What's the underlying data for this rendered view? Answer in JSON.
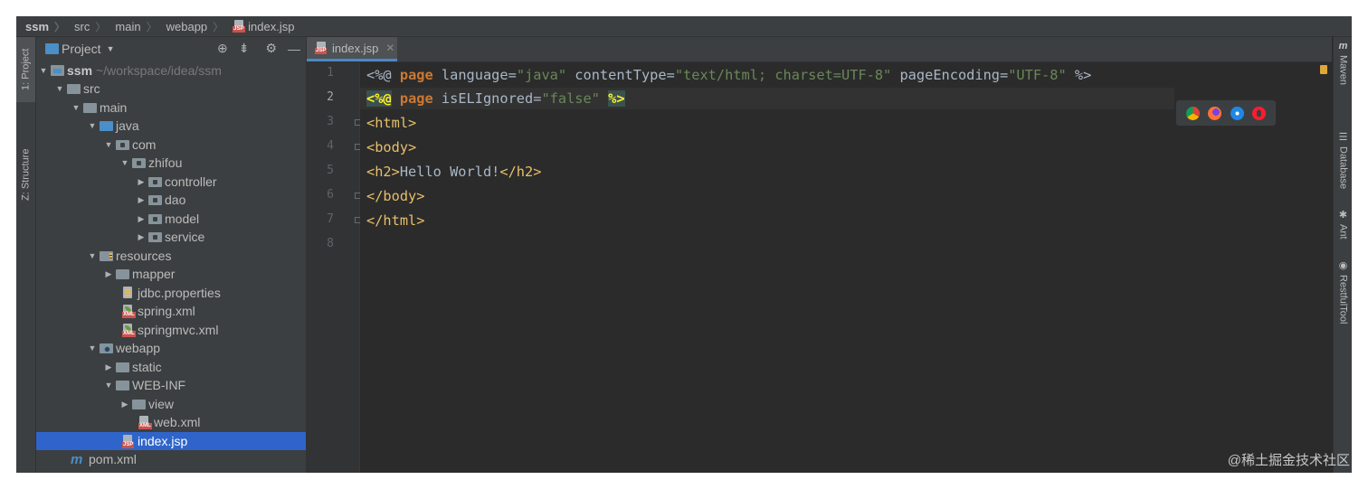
{
  "breadcrumb": [
    {
      "label": "ssm"
    },
    {
      "label": "src"
    },
    {
      "label": "main"
    },
    {
      "label": "webapp"
    },
    {
      "label": "index.jsp"
    }
  ],
  "left_stripe": {
    "project_tab": "1: Project",
    "structure_tab": "Z: Structure"
  },
  "project_panel": {
    "title": "Project",
    "root_name": "ssm",
    "root_path": "~/workspace/idea/ssm",
    "tree": [
      {
        "label": "src"
      },
      {
        "label": "main"
      },
      {
        "label": "java"
      },
      {
        "label": "com"
      },
      {
        "label": "zhifou"
      },
      {
        "label": "controller"
      },
      {
        "label": "dao"
      },
      {
        "label": "model"
      },
      {
        "label": "service"
      },
      {
        "label": "resources"
      },
      {
        "label": "mapper"
      },
      {
        "label": "jdbc.properties"
      },
      {
        "label": "spring.xml"
      },
      {
        "label": "springmvc.xml"
      },
      {
        "label": "webapp"
      },
      {
        "label": "static"
      },
      {
        "label": "WEB-INF"
      },
      {
        "label": "view"
      },
      {
        "label": "web.xml"
      },
      {
        "label": "index.jsp"
      },
      {
        "label": "pom.xml"
      }
    ]
  },
  "editor": {
    "tab_label": "index.jsp",
    "line_numbers": [
      "1",
      "2",
      "3",
      "4",
      "5",
      "6",
      "7",
      "8"
    ],
    "lines": [
      {
        "open": "<%@",
        "kw": "page",
        "a1": " language=",
        "v1": "\"java\"",
        "a2": " contentType=",
        "v2": "\"text/html; charset=UTF-8\"",
        "a3": " pageEncoding=",
        "v3": "\"UTF-8\"",
        "close": " %>"
      },
      {
        "open": "<%@",
        "sp": " ",
        "kw": "page",
        "a1": " isELIgnored=",
        "v1": "\"false\"",
        "sp2": " ",
        "close": "%>"
      },
      {
        "text": "<html>"
      },
      {
        "text": "<body>"
      },
      {
        "t1": "<h2>",
        "body": "Hello World!",
        "t2": "</h2>"
      },
      {
        "text": "</body>"
      },
      {
        "text": "</html>"
      }
    ]
  },
  "right_stripe": {
    "maven": "Maven",
    "database": "Database",
    "ant": "Ant",
    "restful": "RestfulTool"
  },
  "watermark": "@稀土掘金技术社区"
}
